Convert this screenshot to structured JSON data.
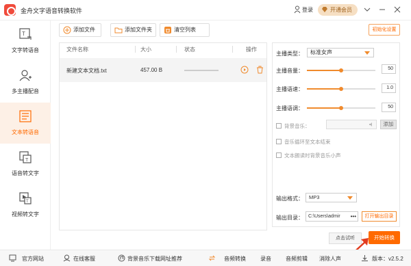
{
  "app": {
    "title": "金舟文字语音转换软件",
    "login": "登录",
    "vip": "开通会员"
  },
  "nav": [
    {
      "label": "文字转语音",
      "icon": "text-to-speech-icon",
      "active": false
    },
    {
      "label": "多主播配音",
      "icon": "multi-anchor-icon",
      "active": false
    },
    {
      "label": "文本转语音",
      "icon": "document-to-speech-icon",
      "active": true
    },
    {
      "label": "语音转文字",
      "icon": "speech-to-text-icon",
      "active": false
    },
    {
      "label": "视频转文字",
      "icon": "video-to-text-icon",
      "active": false
    }
  ],
  "toolbar": {
    "add_file": "添加文件",
    "add_folder": "添加文件夹",
    "clear_list": "清空列表",
    "reset_settings": "初始化设置"
  },
  "table": {
    "headers": {
      "name": "文件名称",
      "size": "大小",
      "status": "状态",
      "action": "操作"
    },
    "rows": [
      {
        "name": "新建文本文档.txt",
        "size": "457.00 B",
        "progress": 0
      }
    ]
  },
  "settings": {
    "anchor_type_label": "主播类型：",
    "anchor_type_value": "标准女声",
    "volume_label": "主播音量：",
    "volume_value": "50",
    "volume_fraction": 0.5,
    "speed_label": "主播语速：",
    "speed_value": "1.0",
    "speed_fraction": 0.5,
    "pitch_label": "主播语调：",
    "pitch_value": "50",
    "pitch_fraction": 0.5,
    "bgm_label": "背景音乐：",
    "bgm_add": "添加",
    "loop_label": "音乐循环至文本结束",
    "duck_label": "文本朗读时背景音乐小声",
    "format_label": "输出格式：",
    "format_value": "MP3",
    "dir_label": "输出目录：",
    "dir_value": "C:\\Users\\admir",
    "dir_more": "•••",
    "open_dir": "打开输出目录"
  },
  "actions": {
    "preview": "点击试听",
    "start": "开始转换"
  },
  "statusbar": {
    "website": "官方网站",
    "support": "在线客服",
    "bgm_recommend": "背景音乐下载网址推荐",
    "audio_convert": "音频转换",
    "record": "录音",
    "audio_cut": "音频剪辑",
    "vocal_remove": "消除人声",
    "version": "版本：v2.5.2"
  },
  "colors": {
    "accent": "#ff6a00",
    "active_bg": "#fdf0e6",
    "logo": "#f04b3c"
  }
}
